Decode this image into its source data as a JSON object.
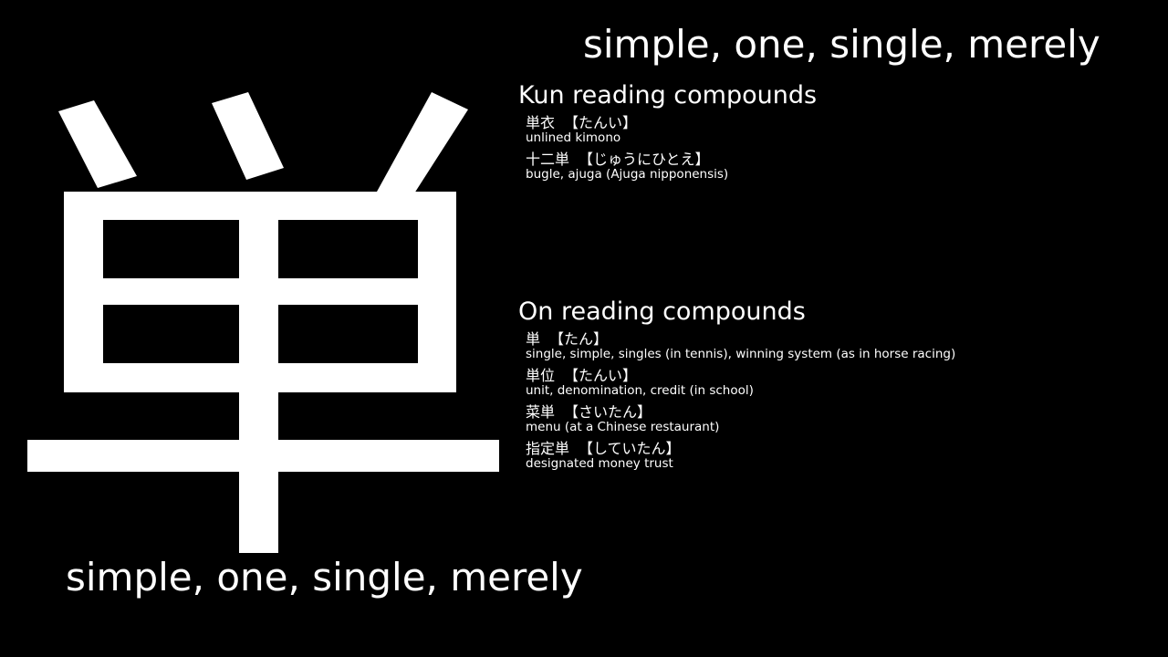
{
  "kanji": {
    "character": "単"
  },
  "meaning_top": "simple, one, single, merely",
  "meaning_bottom": "simple, one, single, merely",
  "kun_section": {
    "heading": "Kun reading compounds",
    "entries": [
      {
        "word": "単衣",
        "reading": "【たんい】",
        "gloss": "unlined kimono"
      },
      {
        "word": "十二単",
        "reading": "【じゅうにひとえ】",
        "gloss": "bugle, ajuga (Ajuga nipponensis)"
      }
    ]
  },
  "on_section": {
    "heading": "On reading compounds",
    "entries": [
      {
        "word": "単",
        "reading": "【たん】",
        "gloss": "single, simple, singles (in tennis), winning system (as in horse racing)"
      },
      {
        "word": "単位",
        "reading": "【たんい】",
        "gloss": "unit, denomination, credit (in school)"
      },
      {
        "word": "菜単",
        "reading": "【さいたん】",
        "gloss": "menu (at a Chinese restaurant)"
      },
      {
        "word": "指定単",
        "reading": "【していたん】",
        "gloss": "designated money trust"
      }
    ]
  }
}
